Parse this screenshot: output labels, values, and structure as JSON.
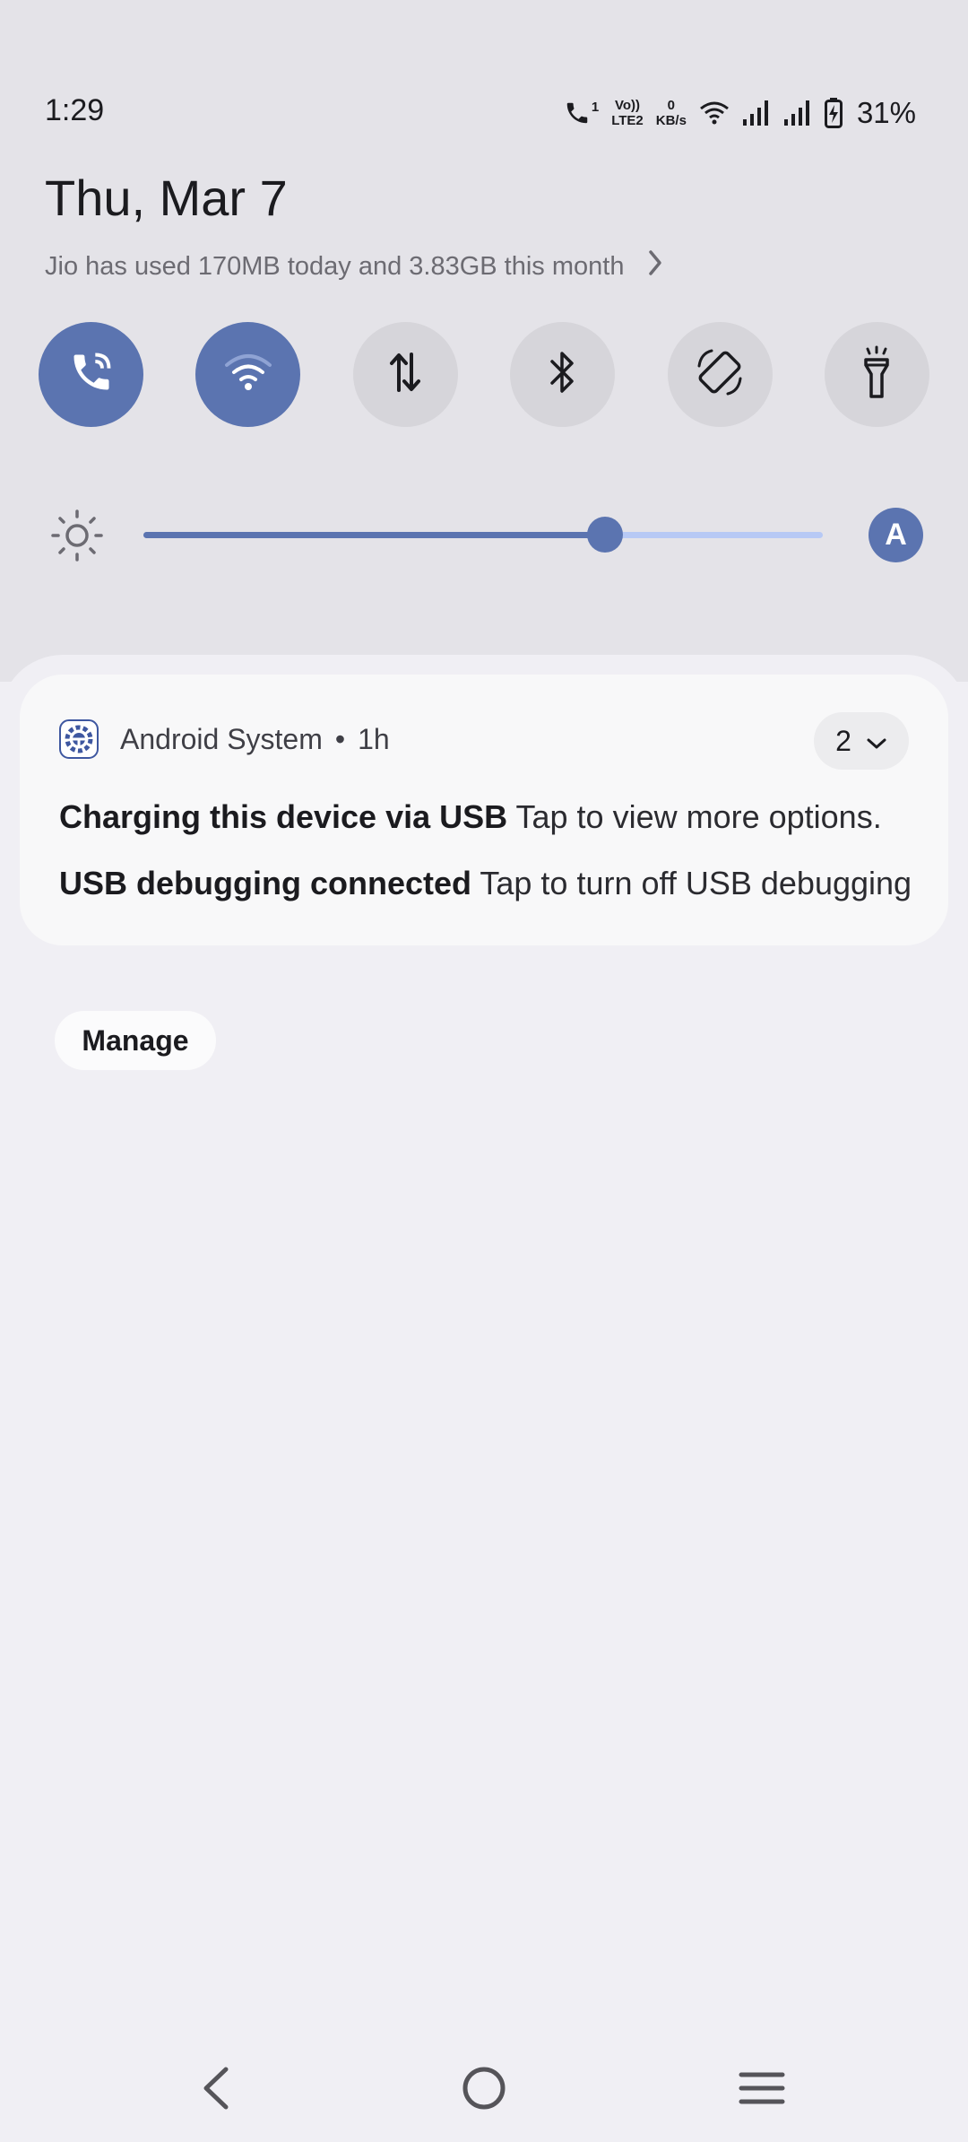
{
  "status_bar": {
    "time": "1:29",
    "call_sim": "1",
    "volte_line1": "Vo))",
    "volte_line2": "LTE2",
    "net_speed_value": "0",
    "net_speed_unit": "KB/s",
    "battery_percent": "31%"
  },
  "header": {
    "date": "Thu, Mar 7",
    "data_usage": "Jio has used 170MB today and 3.83GB this month"
  },
  "quick_settings": {
    "tiles": [
      {
        "name": "volte-call",
        "icon": "phone-icon",
        "state": "on"
      },
      {
        "name": "wifi",
        "icon": "wifi-icon",
        "state": "on"
      },
      {
        "name": "mobile-data",
        "icon": "data-arrows-icon",
        "state": "off"
      },
      {
        "name": "bluetooth",
        "icon": "bluetooth-icon",
        "state": "off"
      },
      {
        "name": "auto-rotate",
        "icon": "rotate-icon",
        "state": "off"
      },
      {
        "name": "flashlight",
        "icon": "flashlight-icon",
        "state": "off"
      }
    ],
    "brightness_level": 0.68,
    "auto_brightness_label": "A"
  },
  "notification": {
    "app_name": "Android System",
    "separator": "•",
    "time": "1h",
    "count": "2",
    "items": [
      {
        "title": "Charging this device via USB",
        "text": "Tap to view more options."
      },
      {
        "title": "USB debugging connected",
        "text": "Tap to turn off USB debugging"
      }
    ]
  },
  "manage_label": "Manage",
  "colors": {
    "accent": "#5b74b0",
    "accent_light": "#b7c9f5",
    "tile_off": "#d6d5da",
    "panel_bg": "#f0eff4",
    "card_bg": "#f8f8f9"
  }
}
